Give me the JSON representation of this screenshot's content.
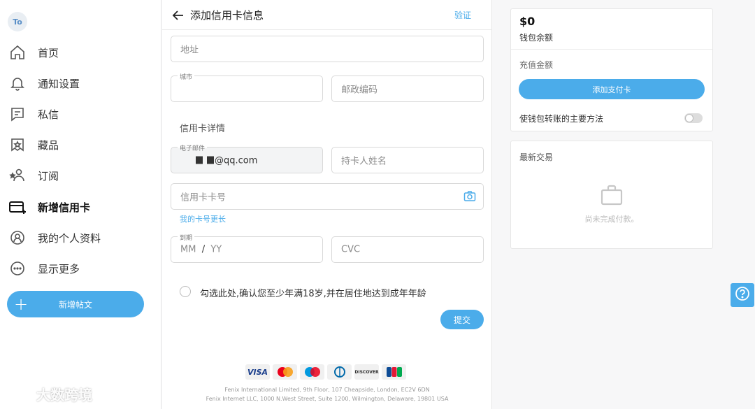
{
  "sidebar": {
    "avatar": "To",
    "items": [
      {
        "label": "首页",
        "icon": "home-icon"
      },
      {
        "label": "通知设置",
        "icon": "bell-icon"
      },
      {
        "label": "私信",
        "icon": "message-icon"
      },
      {
        "label": "藏品",
        "icon": "bookmark-icon"
      },
      {
        "label": "订阅",
        "icon": "subscriptions-icon"
      },
      {
        "label": "新增信用卡",
        "icon": "credit-card-add-icon",
        "active": true
      },
      {
        "label": "我的个人资料",
        "icon": "profile-icon"
      },
      {
        "label": "显示更多",
        "icon": "more-icon"
      }
    ],
    "new_post": "新增帖文"
  },
  "main": {
    "title": "添加信用卡信息",
    "verify": "验证",
    "address_placeholder": "地址",
    "city_label": "城市",
    "postal_placeholder": "邮政编码",
    "card_section": "信用卡详情",
    "email_label": "电子邮件",
    "email_value": "@qq.com",
    "cardholder_placeholder": "持卡人姓名",
    "card_number_placeholder": "信用卡卡号",
    "longer_card_link": "我的卡号更长",
    "expiry_label": "到期",
    "expiry_mm": "MM",
    "expiry_sep": "/",
    "expiry_yy": "YY",
    "cvc_placeholder": "CVC",
    "age_confirm": "勾选此处,确认您至少年满18岁,并在居住地达到成年年龄",
    "submit": "提交",
    "card_brands": [
      "VISA",
      "MasterCard",
      "Maestro",
      "Diners Club",
      "DISCOVER",
      "JCB"
    ],
    "footer_line1": "Fenix International Limited, 9th Floor, 107 Cheapside, London, EC2V 6DN",
    "footer_line2": "Fenix Internet LLC, 1000 N.West Street, Suite 1200, Wilmington, Delaware, 19801 USA"
  },
  "wallet": {
    "balance": "$0",
    "balance_label": "钱包余额",
    "topup_label": "充值金额",
    "add_card": "添加支付卡",
    "primary_method": "使钱包转账的主要方法"
  },
  "transactions": {
    "title": "最新交易",
    "empty": "尚未完成付款。"
  },
  "watermark": "大数跨境",
  "colors": {
    "accent": "#4bacea"
  }
}
